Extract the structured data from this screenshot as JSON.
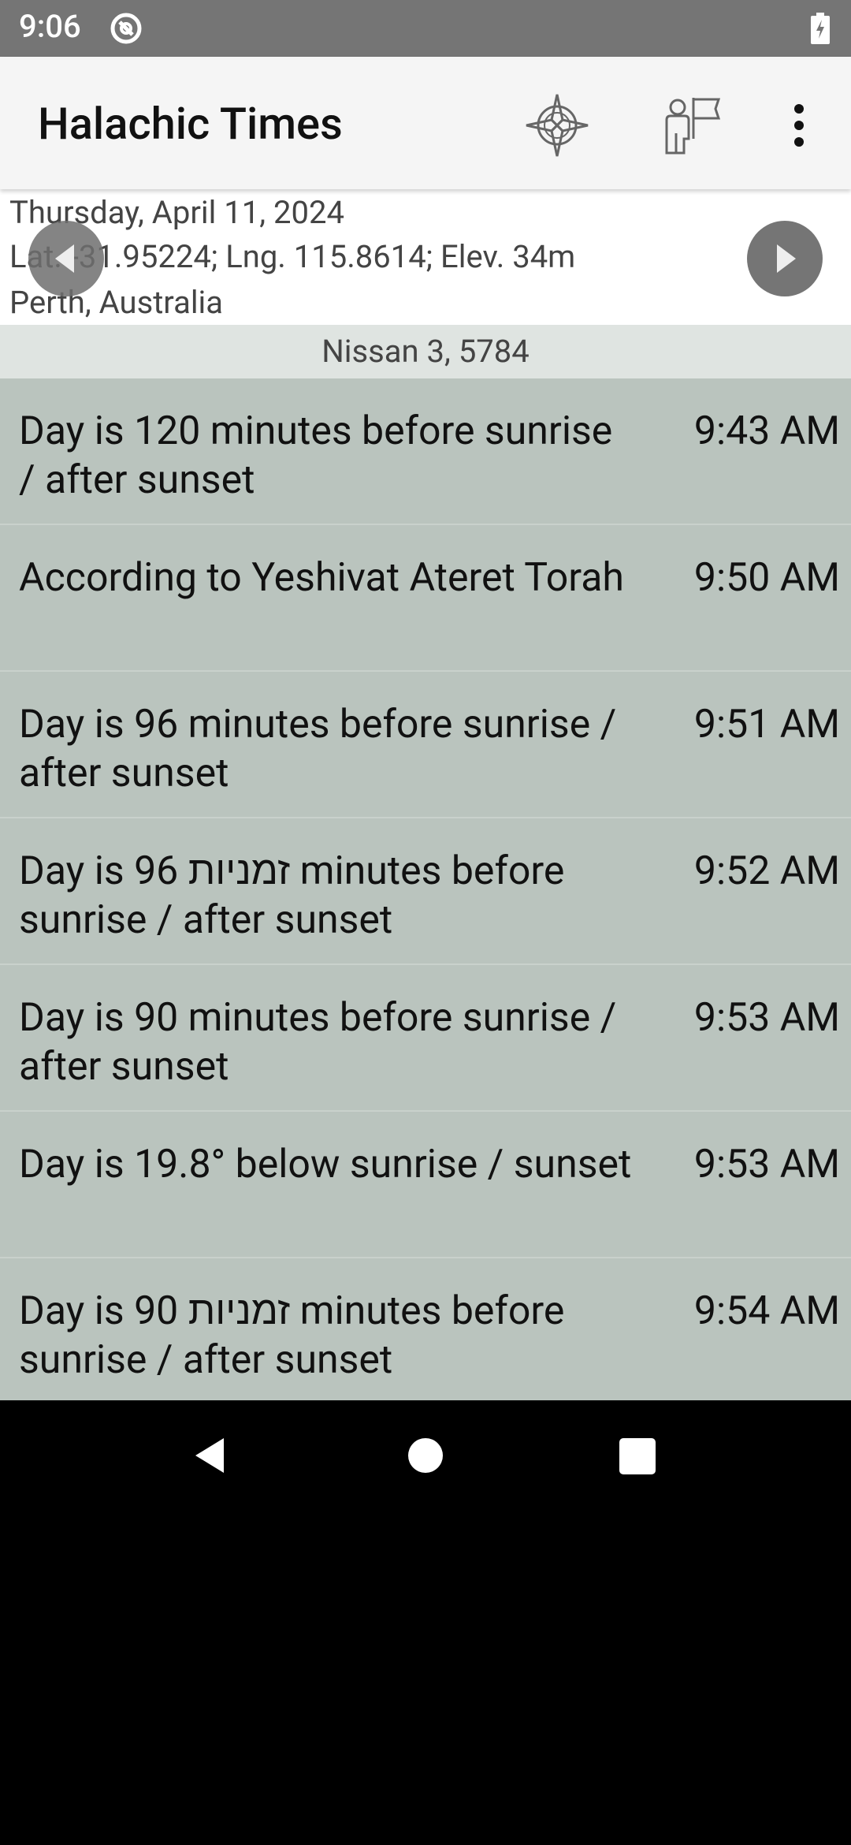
{
  "status_bar": {
    "time": "9:06"
  },
  "app_bar": {
    "title": "Halachic Times"
  },
  "header": {
    "date": "Thursday, April 11, 2024",
    "coordinates": "Lat. -31.95224; Lng. 115.8614; Elev. 34m",
    "place": "Perth, Australia"
  },
  "hebrew_date": "Nissan 3, 5784",
  "times": [
    {
      "label": "Day is 120 minutes before sunrise / after sunset",
      "time": "9:43 AM"
    },
    {
      "label": "According to Yeshivat Ateret Torah",
      "time": "9:50 AM"
    },
    {
      "label": "Day is 96 minutes before sunrise / after sunset",
      "time": "9:51 AM"
    },
    {
      "label": "Day is 96 זמניות minutes before sunrise / after sunset",
      "time": "9:52 AM"
    },
    {
      "label": "Day is 90 minutes before sunrise / after sunset",
      "time": "9:53 AM"
    },
    {
      "label": "Day is 19.8° below sunrise / sunset",
      "time": "9:53 AM"
    },
    {
      "label": "Day is 90 זמניות minutes before sunrise / after sunset",
      "time": "9:54 AM"
    }
  ],
  "icons": {
    "sync": "sync-icon",
    "battery": "battery-charging-icon",
    "compass": "compass-icon",
    "location": "location-icon",
    "overflow": "more-vert-icon",
    "prev": "chevron-left-icon",
    "next": "chevron-right-icon"
  },
  "colors": {
    "status_bar": "#757575",
    "app_bar": "#f5f5f5",
    "hebrew_date_bar": "#dfe4e1",
    "list_background": "#bac4be"
  }
}
